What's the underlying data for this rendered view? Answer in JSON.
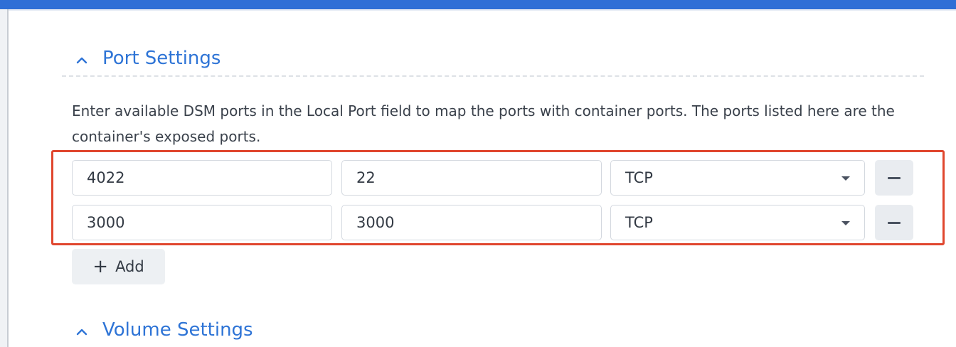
{
  "port_settings": {
    "header": "Port Settings",
    "description": "Enter available DSM ports in the Local Port field to map the ports with container ports. The ports listed here are the container's exposed ports.",
    "rows": [
      {
        "local_port": "4022",
        "container_port": "22",
        "protocol": "TCP"
      },
      {
        "local_port": "3000",
        "container_port": "3000",
        "protocol": "TCP"
      }
    ],
    "add_label": "Add",
    "add_icon": "plus-icon",
    "remove_icon": "minus-icon",
    "collapse_icon": "chevron-up-icon"
  },
  "volume_settings": {
    "header": "Volume Settings"
  },
  "colors": {
    "accent": "#2e74d6",
    "top_bar": "#2f6fd6",
    "highlight_border": "#e0462e"
  }
}
